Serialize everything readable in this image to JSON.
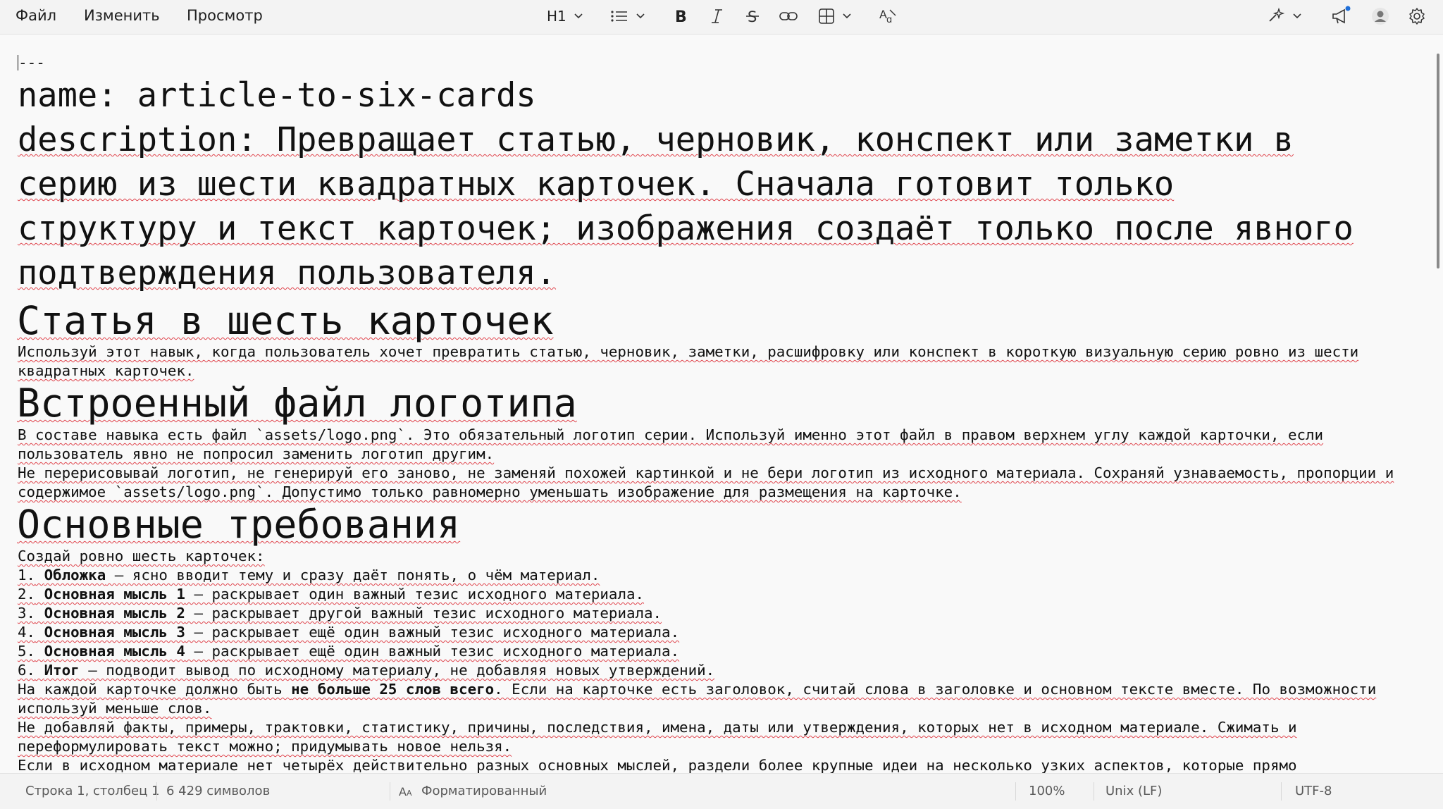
{
  "menu": {
    "file": "Файл",
    "edit": "Изменить",
    "view": "Просмотр"
  },
  "toolbar": {
    "heading": "H1",
    "icons": [
      "heading-dropdown",
      "list-icon",
      "bold-icon",
      "italic-icon",
      "strikethrough-icon",
      "link-icon",
      "table-icon",
      "clear-format-icon",
      "copilot-icon",
      "announce-icon",
      "account-icon",
      "settings-icon"
    ]
  },
  "doc": {
    "frontmatter_dash": "---",
    "fm_name": "name: article-to-six-cards",
    "fm_desc": [
      "description: Превращает статью, черновик, конспект или заметки в",
      "серию из шести квадратных карточек. Сначала готовит только",
      "структуру и текст карточек; изображения создаёт только после явного",
      "подтверждения пользователя."
    ],
    "h_title": "Статья в шесть карточек",
    "p_intro": [
      "Используй этот навык, когда пользователь хочет превратить статью, черновик, заметки, расшифровку или конспект в короткую визуальную серию ровно из шести",
      "квадратных карточек."
    ],
    "h_logo": "Встроенный файл логотипа",
    "p_logo1": [
      "В составе навыка есть файл `assets/logo.png`. Это обязательный логотип серии. Используй именно этот файл в правом верхнем углу каждой карточки, если",
      "пользователь явно не попросил заменить логотип другим."
    ],
    "p_logo2": [
      "Не перерисовывай логотип, не генерируй его заново, не заменяй похожей картинкой и не бери логотип из исходного материала. Сохраняй узнаваемость, пропорции и",
      "содержимое `assets/logo.png`. Допустимо только равномерно уменьшать изображение для размещения на карточке."
    ],
    "h_req": "Основные требования",
    "p_req_intro": "Создай ровно шесть карточек:",
    "list": [
      {
        "num": "1.",
        "bold": "Обложка",
        "rest": " — ясно вводит тему и сразу даёт понять, о чём материал."
      },
      {
        "num": "2.",
        "bold": "Основная мысль 1",
        "rest": " — раскрывает один важный тезис исходного материала."
      },
      {
        "num": "3.",
        "bold": "Основная мысль 2",
        "rest": " — раскрывает другой важный тезис исходного материала."
      },
      {
        "num": "4.",
        "bold": "Основная мысль 3",
        "rest": " — раскрывает ещё один важный тезис исходного материала."
      },
      {
        "num": "5.",
        "bold": "Основная мысль 4",
        "rest": " — раскрывает ещё один важный тезис исходного материала."
      },
      {
        "num": "6.",
        "bold": "Итог",
        "rest": " — подводит вывод по исходному материалу, не добавляя новых утверждений."
      }
    ],
    "p_words_a": "На каждой карточке должно быть ",
    "p_words_b": "не больше 25 слов всего",
    "p_words_c": ". Если на карточке есть заголовок, считай слова в заголовке и основном тексте вместе. По возможности",
    "p_words_2": "используй меньше слов.",
    "p_facts": [
      "Не добавляй факты, примеры, трактовки, статистику, причины, последствия, имена, даты или утверждения, которых нет в исходном материале. Сжимать и",
      "переформулировать текст можно; придумывать новое нельзя."
    ],
    "p_last": "Если в исходном материале нет четырёх действительно разных основных мыслей, раздели более крупные идеи на несколько узких аспектов, которые прямо"
  },
  "status": {
    "position": "Строка 1, столбец 1",
    "chars": "6 429 символов",
    "mode": "Форматированный",
    "zoom": "100%",
    "line_ending": "Unix (LF)",
    "encoding": "UTF-8"
  },
  "colors": {
    "spell_underline": "#e0444c",
    "notify_dot": "#1e6fd9"
  }
}
